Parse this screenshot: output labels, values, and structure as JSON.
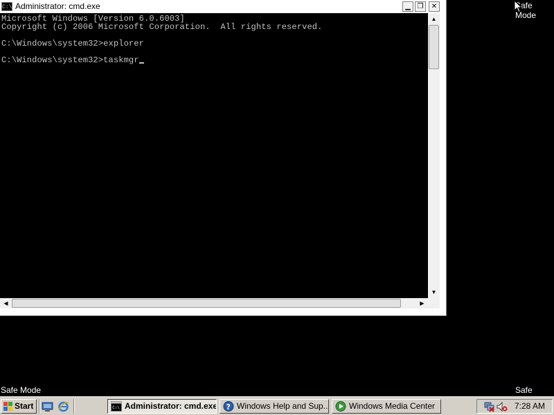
{
  "desktop": {
    "safe_mode_label": "Safe Mode"
  },
  "window": {
    "title": "Administrator: cmd.exe",
    "icon_text": "C:\\",
    "min_glyph": "▁",
    "max_glyph": "❐",
    "close_glyph": "✕"
  },
  "console": {
    "lines": [
      "Microsoft Windows [Version 6.0.6003]",
      "Copyright (c) 2006 Microsoft Corporation.  All rights reserved.",
      "",
      "C:\\Windows\\system32>explorer",
      "",
      "C:\\Windows\\system32>taskmgr"
    ]
  },
  "scrollbars": {
    "up": "▲",
    "down": "▼",
    "left": "◀",
    "right": "▶"
  },
  "taskbar": {
    "start_label": "Start",
    "tasks": [
      {
        "label": "Administrator: cmd.exe",
        "icon": "cmd-icon",
        "active": true
      },
      {
        "label": "Windows Help and Sup...",
        "icon": "help-icon",
        "active": false
      },
      {
        "label": "Windows Media Center",
        "icon": "media-center-icon",
        "active": false
      }
    ],
    "quick_launch": [
      "show-desktop-icon",
      "internet-explorer-icon"
    ],
    "clock": "7:28 AM"
  }
}
